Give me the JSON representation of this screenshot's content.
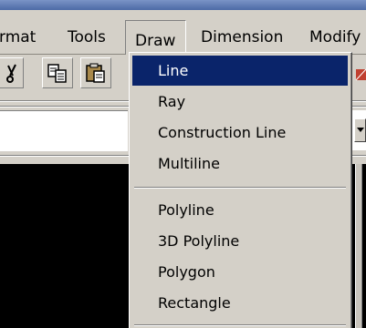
{
  "menubar": {
    "items": [
      {
        "label": "rmat"
      },
      {
        "label": "Tools"
      },
      {
        "label": "Draw"
      },
      {
        "label": "Dimension"
      },
      {
        "label": "Modify"
      }
    ]
  },
  "toolbar": {
    "buttons": [
      {
        "icon": "cut-icon"
      },
      {
        "icon": "copy-icon"
      },
      {
        "icon": "paste-icon"
      }
    ]
  },
  "draw_menu": {
    "groups": [
      {
        "items": [
          {
            "label": "Line",
            "selected": true
          },
          {
            "label": "Ray"
          },
          {
            "label": "Construction Line"
          },
          {
            "label": "Multiline"
          }
        ]
      },
      {
        "items": [
          {
            "label": "Polyline"
          },
          {
            "label": "3D Polyline"
          },
          {
            "label": "Polygon"
          },
          {
            "label": "Rectangle"
          }
        ]
      }
    ]
  },
  "colors": {
    "highlight": "#0a246a",
    "menu_bg": "#d4d0c8",
    "canvas": "#000000"
  }
}
